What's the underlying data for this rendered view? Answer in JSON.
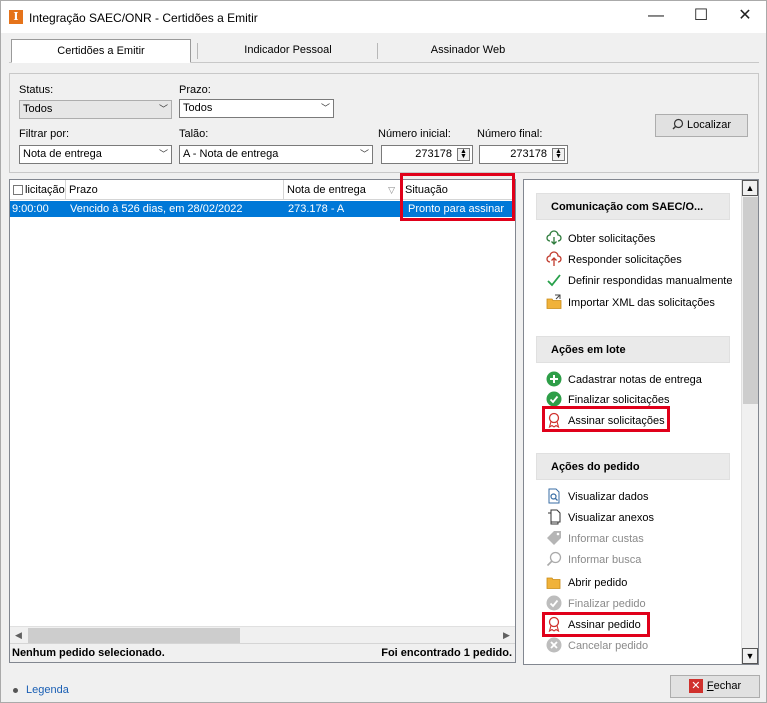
{
  "window": {
    "title": "Integração SAEC/ONR - Certidões a Emitir",
    "app_icon_letter": "I",
    "minimize": "—",
    "maximize": "☐",
    "close": "✕"
  },
  "tabs": [
    {
      "label": "Certidões a Emitir",
      "active": true
    },
    {
      "label": "Indicador Pessoal",
      "active": false
    },
    {
      "label": "Assinador Web",
      "active": false
    }
  ],
  "filters": {
    "status_label": "Status:",
    "status_value": "Todos",
    "prazo_label": "Prazo:",
    "prazo_value": "Todos",
    "filtrar_label": "Filtrar por:",
    "filtrar_value": "Nota de entrega",
    "talao_label": "Talão:",
    "talao_value": "A - Nota de entrega",
    "num_inicial_label": "Número inicial:",
    "num_inicial_value": "273178",
    "num_final_label": "Número final:",
    "num_final_value": "273178",
    "localizar_label": "Localizar"
  },
  "grid": {
    "columns": [
      "licitação",
      "Prazo",
      "Nota de entrega",
      "Situação"
    ],
    "rows": [
      {
        "solicitacao": "9:00:00",
        "prazo": "Vencido à 526 dias, em 28/02/2022",
        "nota": "273.178 - A",
        "situacao": "Pronto para assinar"
      }
    ],
    "status_left": "Nenhum pedido selecionado.",
    "status_right": "Foi encontrado 1 pedido."
  },
  "side": {
    "groups": [
      {
        "title": "Comunicação com SAEC/O...",
        "items": [
          "Obter solicitações",
          "Responder solicitações",
          "Definir respondidas manualmente",
          "Importar XML das solicitações"
        ]
      },
      {
        "title": "Ações em lote",
        "items": [
          "Cadastrar notas de entrega",
          "Finalizar solicitações",
          "Assinar solicitações"
        ]
      },
      {
        "title": "Ações do pedido",
        "items": [
          "Visualizar dados",
          "Visualizar anexos",
          "Informar custas",
          "Informar busca",
          "Abrir pedido",
          "Finalizar pedido",
          "Assinar pedido",
          "Cancelar pedido"
        ]
      }
    ]
  },
  "footer": {
    "legend": "Legenda",
    "fechar_prefix": "F",
    "fechar_rest": "echar"
  },
  "colors": {
    "selection": "#0078d7",
    "highlight": "#e0001a",
    "accent": "#e5731a"
  }
}
